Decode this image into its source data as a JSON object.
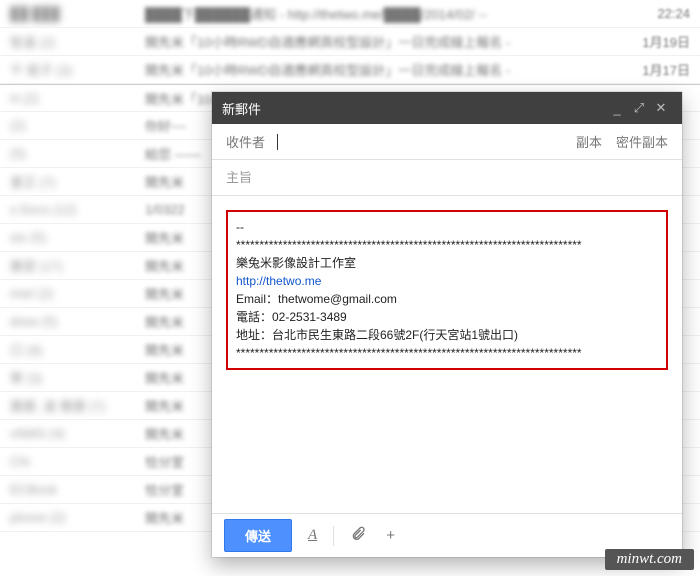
{
  "inbox": {
    "rows": [
      {
        "sender": "██ ███",
        "subject": "████下██████通知 - http://thetwo.me/████/2014/02/ --",
        "date": "22:24"
      },
      {
        "sender": "智逢 (2)",
        "subject": "開先米「10小時RWD自適應網頁校型設計」一日完成線上報名 -",
        "date": "1月19日"
      },
      {
        "sender": "千 姬子 (3)",
        "subject": "開先米「10小時RWD自適應網頁校型設計」一日完成線上報名 -",
        "date": "1月17日"
      },
      {
        "sender": "H (2)",
        "subject": "開先米「10小",
        "date": ""
      },
      {
        "sender": "(2)",
        "subject": "你好~~",
        "date": ""
      },
      {
        "sender": "(5)",
        "subject": "給您 ——",
        "date": ""
      },
      {
        "sender": "堇芷 (7)",
        "subject": "開先米",
        "date": ""
      },
      {
        "sender": "s Docs (12)",
        "subject": "1/0322",
        "date": ""
      },
      {
        "sender": "sts (5)",
        "subject": "開先米",
        "date": ""
      },
      {
        "sender": "團習 (17)",
        "subject": "開先米",
        "date": ""
      },
      {
        "sender": "miel (2)",
        "subject": "開先米",
        "date": ""
      },
      {
        "sender": "drew (5)",
        "subject": "開先米",
        "date": ""
      },
      {
        "sender": "口 (9)",
        "subject": "開先米",
        "date": ""
      },
      {
        "sender": "寒 (3)",
        "subject": "開先米",
        "date": ""
      },
      {
        "sender": "團曆, 逢 團曆 (7)",
        "subject": "開先米",
        "date": ""
      },
      {
        "sender": "vNMS (4)",
        "subject": "開先米",
        "date": ""
      },
      {
        "sender": "Chi",
        "subject": "恰分室",
        "date": ""
      },
      {
        "sender": "ECBsok",
        "subject": "恰分室",
        "date": ""
      },
      {
        "sender": "phone (2)",
        "subject": "開先米",
        "date": ""
      }
    ]
  },
  "compose": {
    "title": "新郵件",
    "recipients_label": "收件者",
    "cc_label": "副本",
    "bcc_label": "密件副本",
    "subject_placeholder": "主旨",
    "signature": {
      "sep": "--",
      "stars": "**************************************************************************",
      "name": "樂兔米影像設計工作室",
      "url": "http://thetwo.me",
      "email_line": "Email：thetwome@gmail.com",
      "phone_line": "電話：02-2531-3489",
      "address_line": "地址：台北市民生東路二段66號2F(行天宮站1號出口)",
      "stars2": "**************************************************************************"
    },
    "send_label": "傳送",
    "format_icon": "A",
    "attach_icon": "attachment",
    "insert_icon": "+"
  },
  "watermark": "minwt.com"
}
